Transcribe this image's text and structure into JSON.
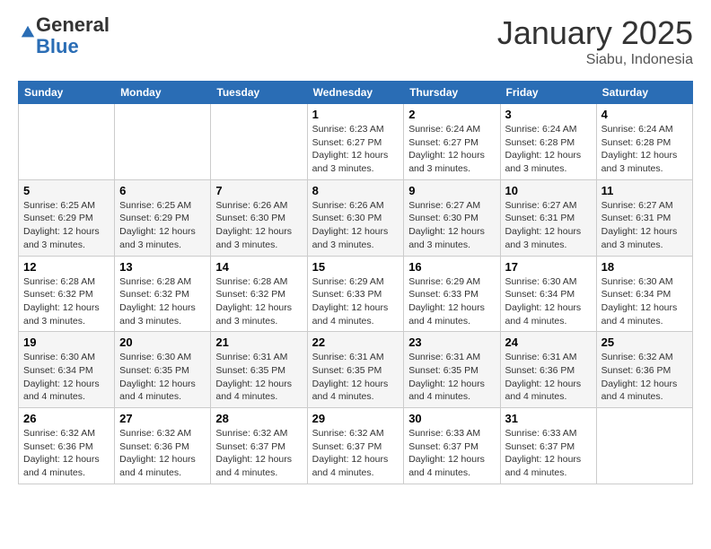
{
  "logo": {
    "general": "General",
    "blue": "Blue"
  },
  "header": {
    "month": "January 2025",
    "location": "Siabu, Indonesia"
  },
  "weekdays": [
    "Sunday",
    "Monday",
    "Tuesday",
    "Wednesday",
    "Thursday",
    "Friday",
    "Saturday"
  ],
  "weeks": [
    [
      {
        "day": "",
        "info": ""
      },
      {
        "day": "",
        "info": ""
      },
      {
        "day": "",
        "info": ""
      },
      {
        "day": "1",
        "info": "Sunrise: 6:23 AM\nSunset: 6:27 PM\nDaylight: 12 hours\nand 3 minutes."
      },
      {
        "day": "2",
        "info": "Sunrise: 6:24 AM\nSunset: 6:27 PM\nDaylight: 12 hours\nand 3 minutes."
      },
      {
        "day": "3",
        "info": "Sunrise: 6:24 AM\nSunset: 6:28 PM\nDaylight: 12 hours\nand 3 minutes."
      },
      {
        "day": "4",
        "info": "Sunrise: 6:24 AM\nSunset: 6:28 PM\nDaylight: 12 hours\nand 3 minutes."
      }
    ],
    [
      {
        "day": "5",
        "info": "Sunrise: 6:25 AM\nSunset: 6:29 PM\nDaylight: 12 hours\nand 3 minutes."
      },
      {
        "day": "6",
        "info": "Sunrise: 6:25 AM\nSunset: 6:29 PM\nDaylight: 12 hours\nand 3 minutes."
      },
      {
        "day": "7",
        "info": "Sunrise: 6:26 AM\nSunset: 6:30 PM\nDaylight: 12 hours\nand 3 minutes."
      },
      {
        "day": "8",
        "info": "Sunrise: 6:26 AM\nSunset: 6:30 PM\nDaylight: 12 hours\nand 3 minutes."
      },
      {
        "day": "9",
        "info": "Sunrise: 6:27 AM\nSunset: 6:30 PM\nDaylight: 12 hours\nand 3 minutes."
      },
      {
        "day": "10",
        "info": "Sunrise: 6:27 AM\nSunset: 6:31 PM\nDaylight: 12 hours\nand 3 minutes."
      },
      {
        "day": "11",
        "info": "Sunrise: 6:27 AM\nSunset: 6:31 PM\nDaylight: 12 hours\nand 3 minutes."
      }
    ],
    [
      {
        "day": "12",
        "info": "Sunrise: 6:28 AM\nSunset: 6:32 PM\nDaylight: 12 hours\nand 3 minutes."
      },
      {
        "day": "13",
        "info": "Sunrise: 6:28 AM\nSunset: 6:32 PM\nDaylight: 12 hours\nand 3 minutes."
      },
      {
        "day": "14",
        "info": "Sunrise: 6:28 AM\nSunset: 6:32 PM\nDaylight: 12 hours\nand 3 minutes."
      },
      {
        "day": "15",
        "info": "Sunrise: 6:29 AM\nSunset: 6:33 PM\nDaylight: 12 hours\nand 4 minutes."
      },
      {
        "day": "16",
        "info": "Sunrise: 6:29 AM\nSunset: 6:33 PM\nDaylight: 12 hours\nand 4 minutes."
      },
      {
        "day": "17",
        "info": "Sunrise: 6:30 AM\nSunset: 6:34 PM\nDaylight: 12 hours\nand 4 minutes."
      },
      {
        "day": "18",
        "info": "Sunrise: 6:30 AM\nSunset: 6:34 PM\nDaylight: 12 hours\nand 4 minutes."
      }
    ],
    [
      {
        "day": "19",
        "info": "Sunrise: 6:30 AM\nSunset: 6:34 PM\nDaylight: 12 hours\nand 4 minutes."
      },
      {
        "day": "20",
        "info": "Sunrise: 6:30 AM\nSunset: 6:35 PM\nDaylight: 12 hours\nand 4 minutes."
      },
      {
        "day": "21",
        "info": "Sunrise: 6:31 AM\nSunset: 6:35 PM\nDaylight: 12 hours\nand 4 minutes."
      },
      {
        "day": "22",
        "info": "Sunrise: 6:31 AM\nSunset: 6:35 PM\nDaylight: 12 hours\nand 4 minutes."
      },
      {
        "day": "23",
        "info": "Sunrise: 6:31 AM\nSunset: 6:35 PM\nDaylight: 12 hours\nand 4 minutes."
      },
      {
        "day": "24",
        "info": "Sunrise: 6:31 AM\nSunset: 6:36 PM\nDaylight: 12 hours\nand 4 minutes."
      },
      {
        "day": "25",
        "info": "Sunrise: 6:32 AM\nSunset: 6:36 PM\nDaylight: 12 hours\nand 4 minutes."
      }
    ],
    [
      {
        "day": "26",
        "info": "Sunrise: 6:32 AM\nSunset: 6:36 PM\nDaylight: 12 hours\nand 4 minutes."
      },
      {
        "day": "27",
        "info": "Sunrise: 6:32 AM\nSunset: 6:36 PM\nDaylight: 12 hours\nand 4 minutes."
      },
      {
        "day": "28",
        "info": "Sunrise: 6:32 AM\nSunset: 6:37 PM\nDaylight: 12 hours\nand 4 minutes."
      },
      {
        "day": "29",
        "info": "Sunrise: 6:32 AM\nSunset: 6:37 PM\nDaylight: 12 hours\nand 4 minutes."
      },
      {
        "day": "30",
        "info": "Sunrise: 6:33 AM\nSunset: 6:37 PM\nDaylight: 12 hours\nand 4 minutes."
      },
      {
        "day": "31",
        "info": "Sunrise: 6:33 AM\nSunset: 6:37 PM\nDaylight: 12 hours\nand 4 minutes."
      },
      {
        "day": "",
        "info": ""
      }
    ]
  ]
}
